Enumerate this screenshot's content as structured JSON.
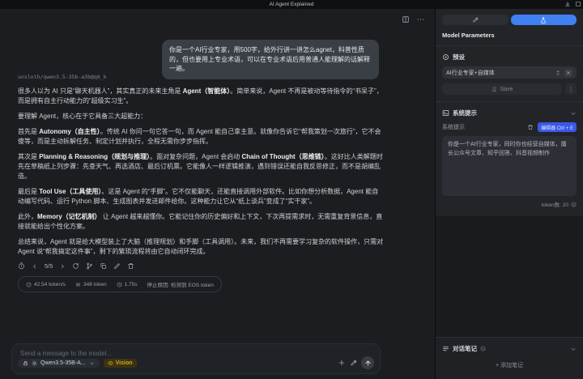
{
  "titlebar": {
    "title": "AI Agent Explained"
  },
  "chat": {
    "user_message": "你是一个AI行业专家，用500字，给外行讲一讲怎么agnet，科普性质的，但也要用上专业术语，可以在专业术语后用普通人能理解的话解释一遍。",
    "model_path": "unsloth/qwen3.5-35b-a3b@q6_k",
    "paragraphs": [
      [
        {
          "t": "很多人以为 AI 只是“聊天机器人”，其实真正的未来主角是 "
        },
        {
          "t": "Agent（智能体）",
          "b": true
        },
        {
          "t": "。简单来说，Agent 不再是被动等待指令的“书呆子”，而是拥有自主行动能力的“超级实习生”。"
        }
      ],
      [
        {
          "t": "要理解 Agent，核心在于它具备三大超能力："
        }
      ],
      [
        {
          "t": "首先是 "
        },
        {
          "t": "Autonomy（自主性）",
          "b": true
        },
        {
          "t": "。传统 AI 你问一句它答一句，而 Agent 能自己拿主意。就像你告诉它“帮我策划一次旅行”，它不会傻等，而是主动拆解任务、制定计划并执行，全程无需你步步指挥。"
        }
      ],
      [
        {
          "t": "其次是 "
        },
        {
          "t": "Planning & Reasoning（规划与推理）",
          "b": true
        },
        {
          "t": "。面对复杂问题，Agent 会启动 "
        },
        {
          "t": "Chain of Thought（思维链）",
          "b": true
        },
        {
          "t": "。这好比人类解题时先在草稿纸上列步骤：先查天气、再选酒店、最后订机票。它能像人一样逻辑推演，遇到错误还能自我反思修正，而不是胡编乱造。"
        }
      ],
      [
        {
          "t": "最后是 "
        },
        {
          "t": "Tool Use（工具使用）",
          "b": true
        },
        {
          "t": "。这是 Agent 的“手脚”。它不仅能聊天，还能直接调用外部软件。比如你想分析数据，Agent 能自动编写代码、运行 Python 脚本、生成图表并发送邮件给你。这种能力让它从“纸上谈兵”变成了“实干家”。"
        }
      ],
      [
        {
          "t": "此外，"
        },
        {
          "t": "Memory（记忆机制）",
          "b": true
        },
        {
          "t": " 让 Agent 越来越懂你。它能记住你的历史偏好和上下文，下次再提需求时，无需重复背景信息，直接就能给出个性化方案。"
        }
      ],
      [
        {
          "t": "总结来说，Agent 就是给大模型装上了大脑（推理规划）和手脚（工具调用）。未来，我们不再需要学习复杂的软件操作，只需对 Agent 说“帮我搞定这件事”，剩下的繁琐流程将由它自动闭环完成。"
        }
      ]
    ],
    "pagination": "5/5",
    "stats": {
      "speed": "42.54 token/s",
      "tokens": "348 token",
      "time": "1.75s",
      "stop_reason": "停止原因: 检测到 EOS token"
    }
  },
  "composer": {
    "placeholder": "Send a message to the model...",
    "model_chip": "Qwen3.5-35B-A...",
    "vision_label": "Vision"
  },
  "sidebar": {
    "heading": "Model Parameters",
    "preset": {
      "label": "预设",
      "value": "AI行业专家+自媒体",
      "save_label": "Save"
    },
    "system_prompt": {
      "section_label": "系统提示",
      "field_label": "系统提示",
      "editor_badge": "编辑器 Ctrl + E",
      "value": "你是一个AI行业专家，同时你也经营自媒体，擅长公众号文章、知乎回答、抖音视频制作",
      "token_count": "token数: 20"
    },
    "notes": {
      "label": "对话笔记",
      "add_label": "+ 添加笔记"
    }
  },
  "icons": {
    "ellipsis": "⋯",
    "kebab": "⋮",
    "accent_blue": "#4080f0",
    "badge_blue": "#3a57e8",
    "vision_amber": "#d3a52f"
  }
}
